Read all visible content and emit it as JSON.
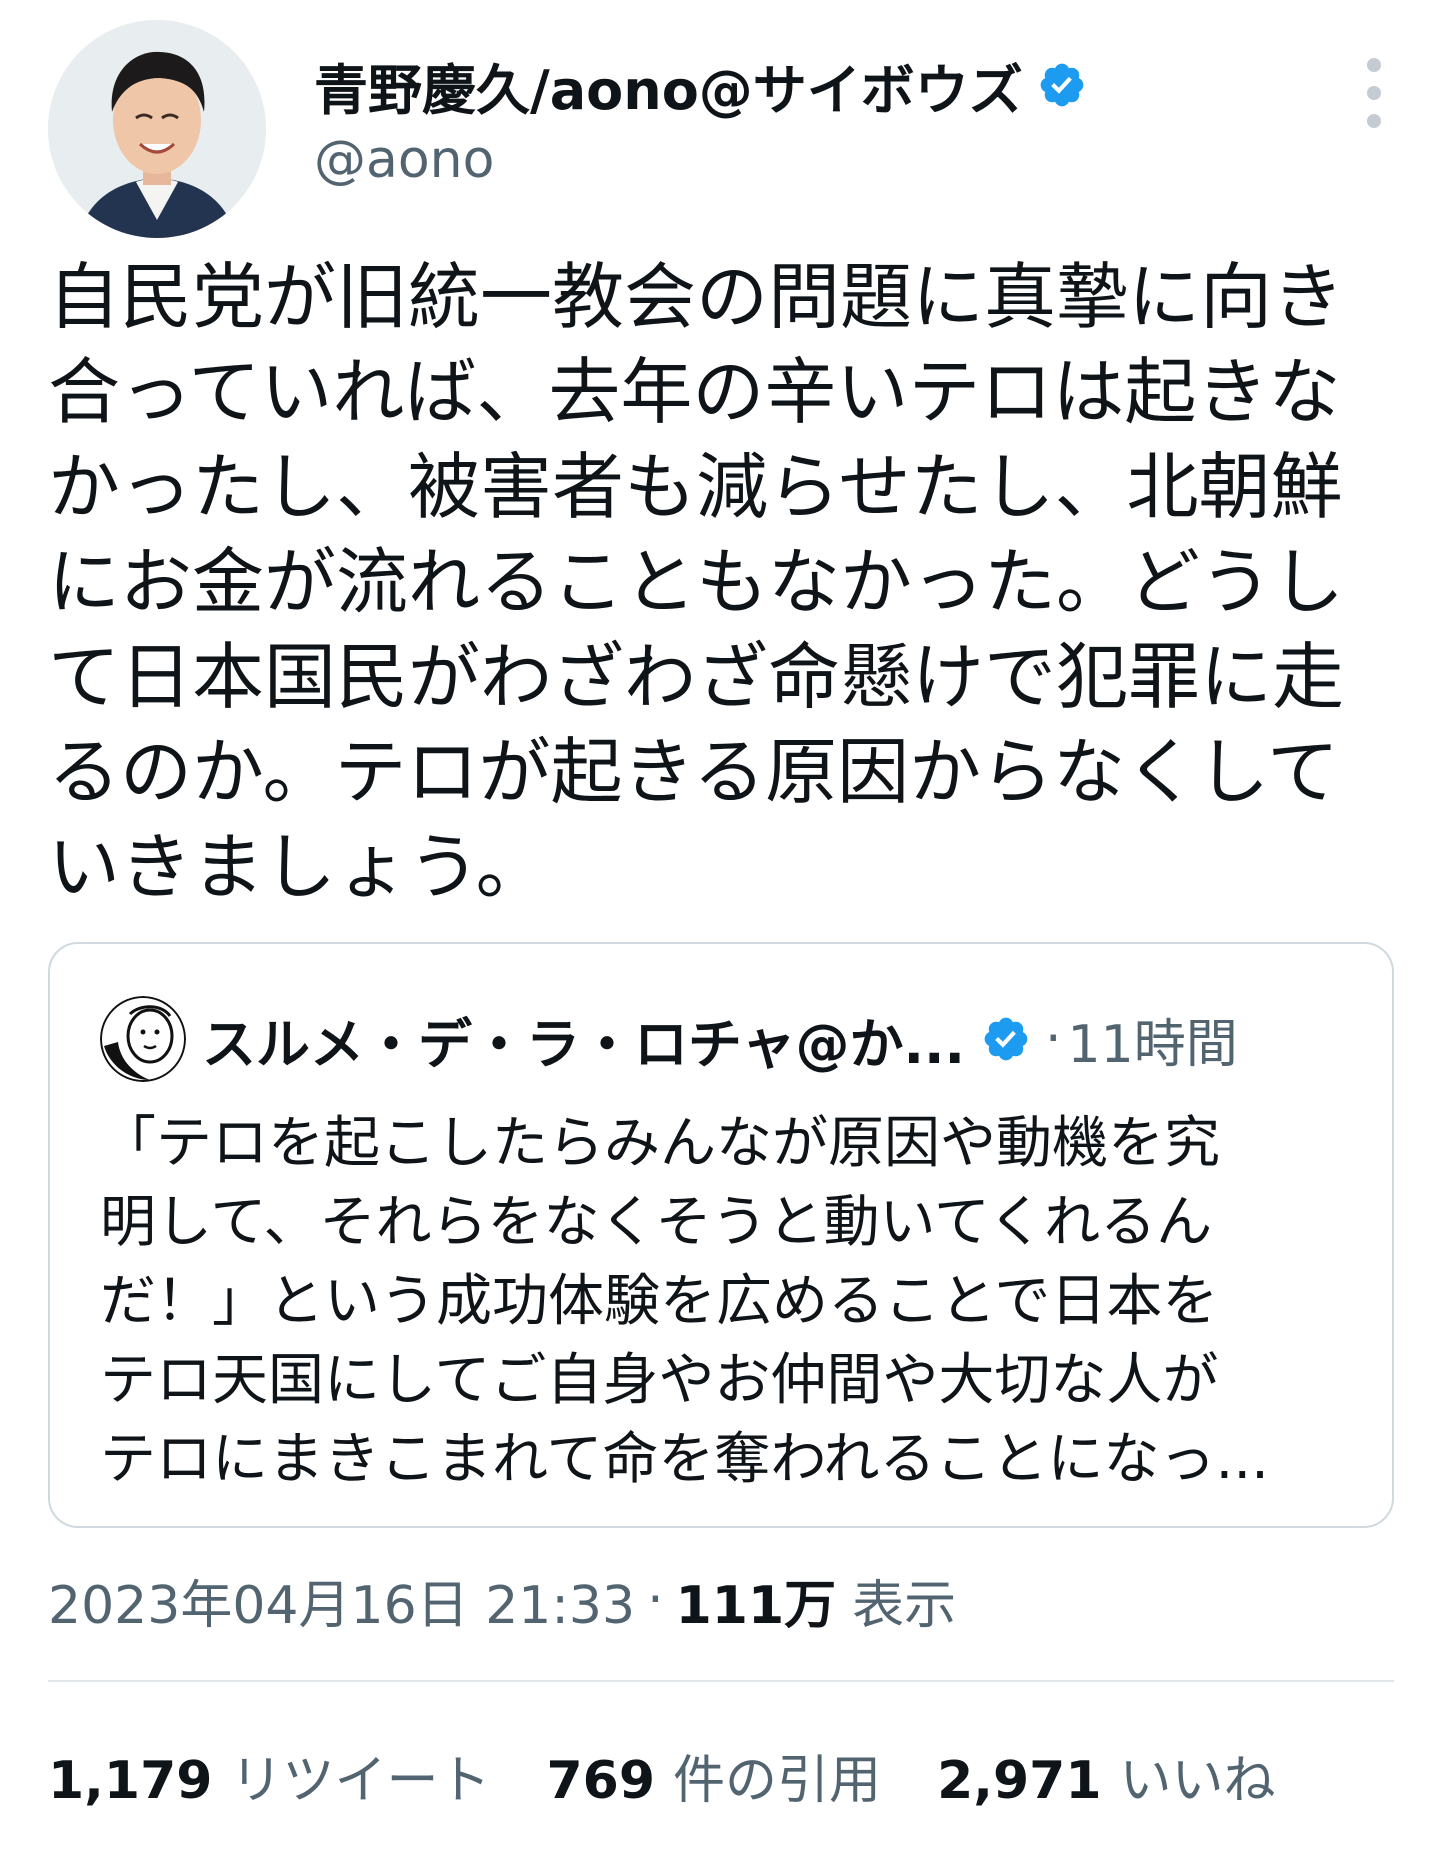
{
  "author": {
    "display_name": "青野慶久/aono@サイボウズ",
    "handle": "@aono",
    "verified": true
  },
  "tweet": {
    "text": "自民党が旧統一教会の問題に真摯に向き\n合っていれば、去年の辛いテロは起きな\nかったし、被害者も減らせたし、北朝鮮\nにお金が流れることもなかった。どうし\nて日本国民がわざわざ命懸けで犯罪に走\nるのか。テロが起きる原因からなくして\nいきましょう。"
  },
  "quoted_tweet": {
    "author_name": "スルメ・デ・ラ・ロチャ@か...",
    "separator": "·",
    "time": "11時間",
    "verified": true,
    "text": "「テロを起こしたらみんなが原因や動機を究\n明して、それらをなくそうと動いてくれるん\nだ！」という成功体験を広めることで日本を\nテロ天国にしてご自身やお仲間や大切な人が\nテロにまきこまれて命を奪われることになっ..."
  },
  "meta": {
    "timestamp": "2023年04月16日 21:33",
    "separator": "·",
    "views_count": "111万",
    "views_label": "表示"
  },
  "stats": {
    "retweets_count": "1,179",
    "retweets_label": "リツイート",
    "quotes_count": "769",
    "quotes_label": "件の引用",
    "likes_count": "2,971",
    "likes_label": "いいね"
  },
  "colors": {
    "verified_blue": "#1d9bf0",
    "secondary_text": "#536471",
    "primary_text": "#0f1419",
    "border": "#cfd9de"
  },
  "icons": {
    "verified": "verified-badge-icon",
    "more": "more-vertical-icon"
  }
}
